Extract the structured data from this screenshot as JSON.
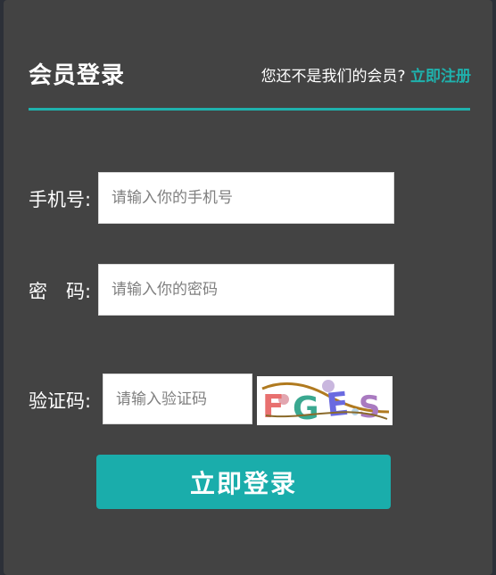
{
  "header": {
    "title": "会员登录",
    "hint_text": "您还不是我们的会员?",
    "register_link": "立即注册"
  },
  "form": {
    "phone_label": "手机号:",
    "phone_placeholder": "请输入你的手机号",
    "password_label": "密　码:",
    "password_placeholder": "请输入你的密码",
    "captcha_label": "验证码:",
    "captcha_placeholder": "请输入验证码",
    "captcha_text": "FGES"
  },
  "actions": {
    "login_label": "立即登录"
  },
  "colors": {
    "accent": "#1fb2ad",
    "panel": "#434343",
    "background": "#2c3038"
  }
}
